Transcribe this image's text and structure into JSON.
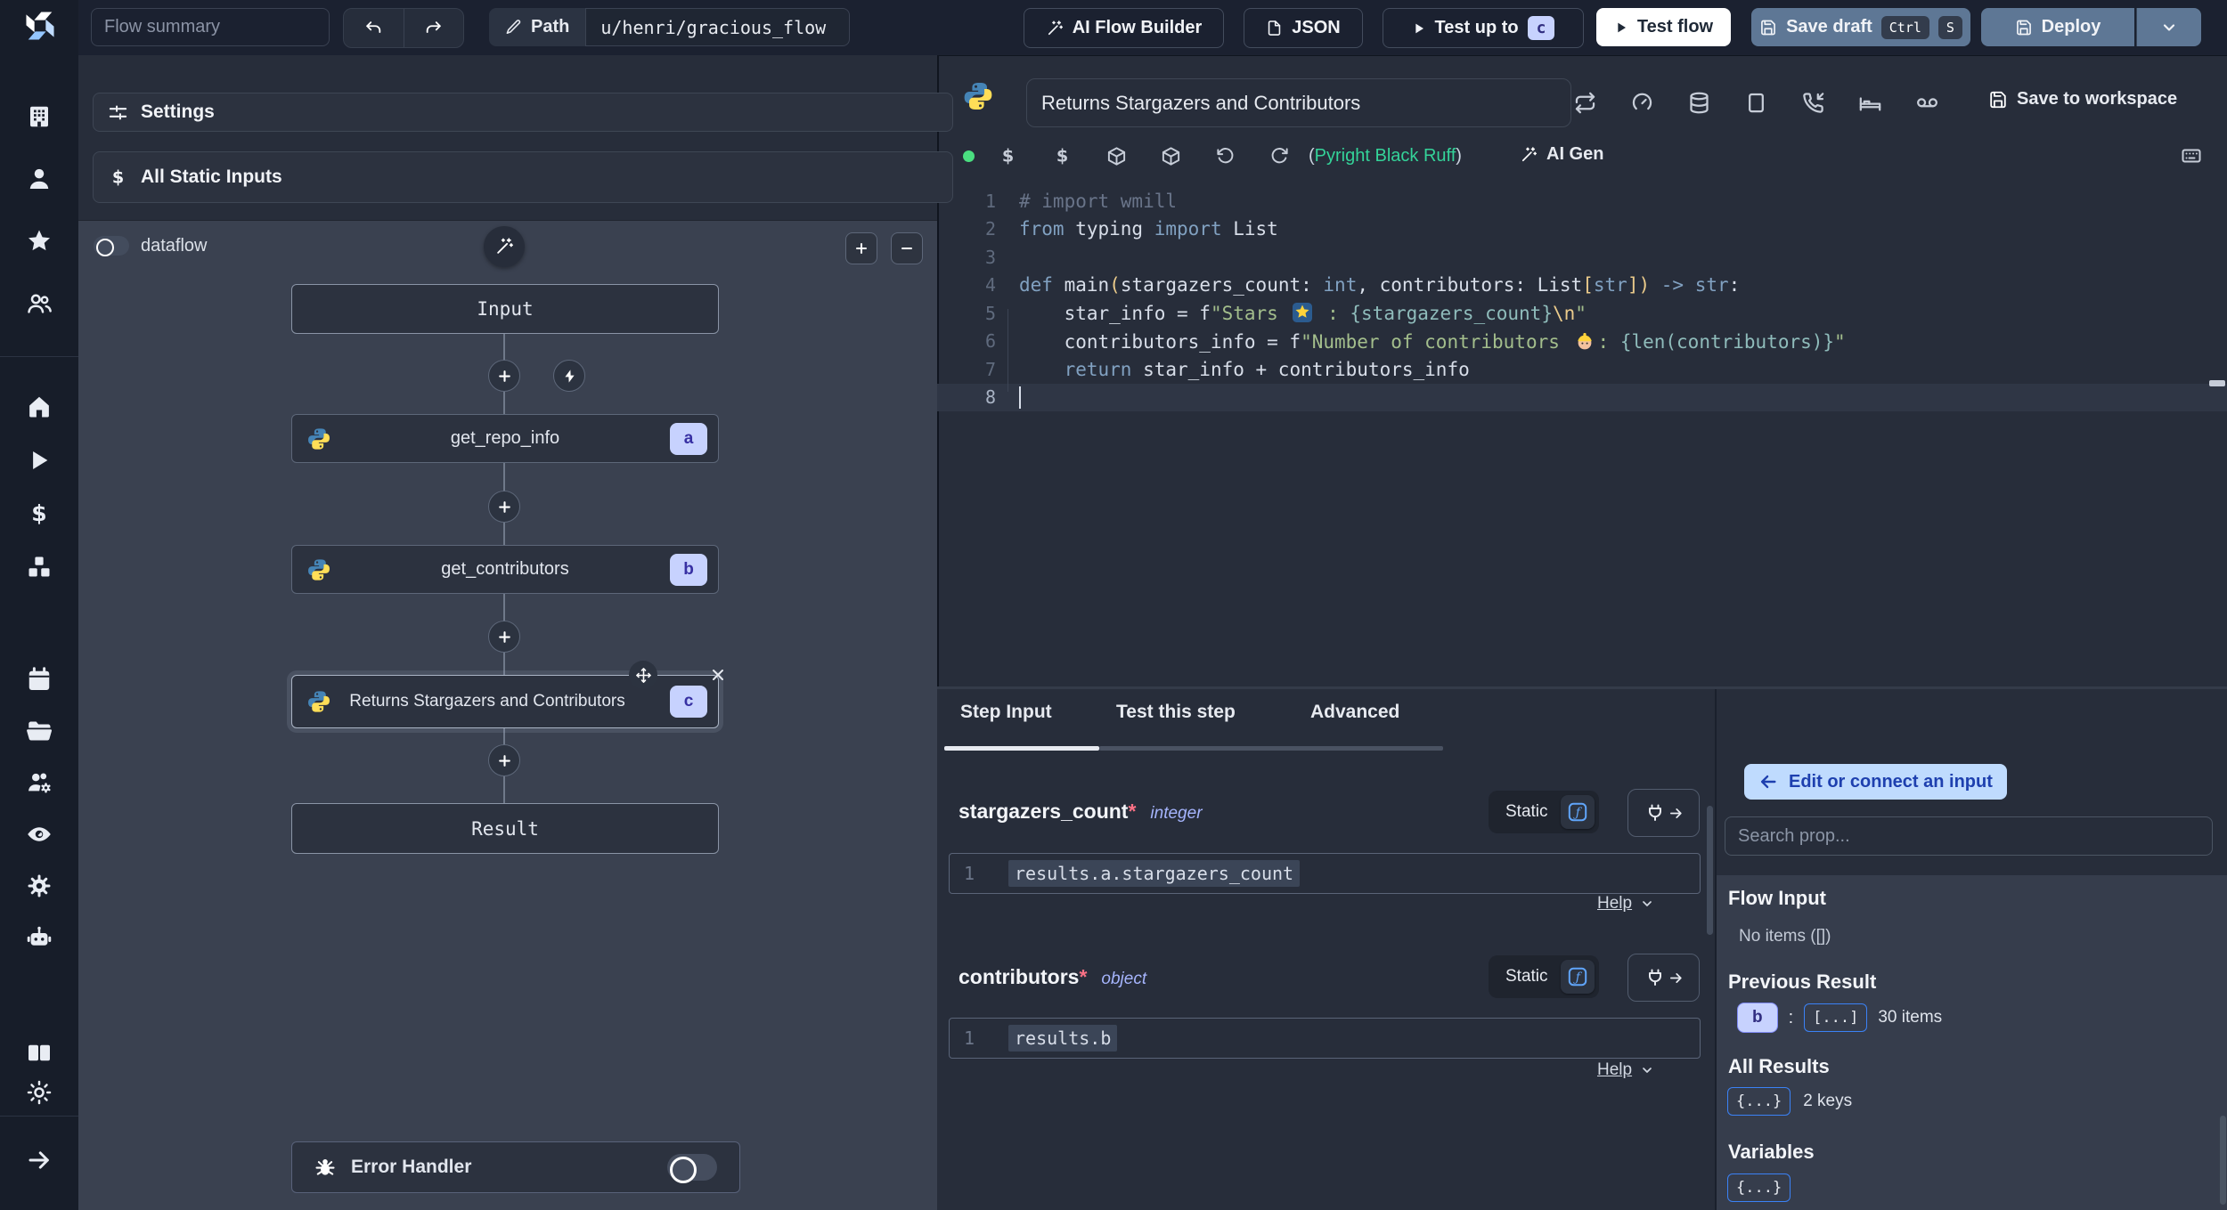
{
  "topbar": {
    "flow_summary": "Flow summary",
    "path_label": "Path",
    "path_value": "u/henri/gracious_flow",
    "ai_flow_builder": "AI Flow Builder",
    "json_button": "JSON",
    "test_up_to": "Test up to",
    "test_up_to_badge": "c",
    "test_flow": "Test flow",
    "save_draft": "Save draft",
    "kbd_ctrl": "Ctrl",
    "kbd_s": "S",
    "deploy": "Deploy"
  },
  "sidebar": {
    "groups": [
      [
        "building",
        "user",
        "star",
        "users"
      ],
      [
        "home",
        "play",
        "dollar",
        "boxes"
      ],
      [
        "calendar",
        "folder",
        "users-gear",
        "eye",
        "gear",
        "bot"
      ],
      [
        "book",
        "sun"
      ]
    ],
    "expand_icon": "arrow-right"
  },
  "flow_panel": {
    "settings": "Settings",
    "all_static_inputs": "All Static Inputs",
    "dataflow": "dataflow",
    "input_node": "Input",
    "steps": [
      {
        "id": "a",
        "label": "get_repo_info"
      },
      {
        "id": "b",
        "label": "get_contributors"
      },
      {
        "id": "c",
        "label": "Returns Stargazers and Contributors"
      }
    ],
    "result_node": "Result",
    "error_handler": "Error Handler"
  },
  "editor": {
    "title": "Returns Stargazers and Contributors",
    "header_icons": [
      "repeat",
      "gauge",
      "database",
      "square",
      "phone-incoming",
      "bed",
      "voicemail"
    ],
    "save_to_workspace": "Save to workspace",
    "toolbar_icons": [
      "dollar",
      "dollar",
      "package",
      "package",
      "rotate-ccw",
      "refresh"
    ],
    "lint_open": "(",
    "lint": "Pyright Black Ruff",
    "lint_close": ")",
    "ai_gen": "AI Gen",
    "code": {
      "lines": [
        {
          "tokens": [
            [
              "cm",
              "# import wmill"
            ]
          ]
        },
        {
          "tokens": [
            [
              "kw",
              "from"
            ],
            [
              "txt",
              " typing "
            ],
            [
              "kw",
              "import"
            ],
            [
              "txt",
              " List"
            ]
          ]
        },
        {
          "tokens": []
        },
        {
          "tokens": [
            [
              "kw",
              "def"
            ],
            [
              "txt",
              " "
            ],
            [
              "fn",
              "main"
            ],
            [
              "br",
              "("
            ],
            [
              "txt",
              "stargazers_count: "
            ],
            [
              "kw",
              "int"
            ],
            [
              "txt",
              ", contributors: List"
            ],
            [
              "br",
              "["
            ],
            [
              "kw",
              "str"
            ],
            [
              "br",
              "])"
            ],
            [
              "txt",
              " "
            ],
            [
              "kw",
              "->"
            ],
            [
              "txt",
              " "
            ],
            [
              "kw",
              "str"
            ],
            [
              "txt",
              ":"
            ]
          ]
        },
        {
          "tokens": [
            [
              "txt",
              "    star_info = f"
            ],
            [
              "str",
              "\"Stars "
            ],
            [
              "emoji",
              "star"
            ],
            [
              "str",
              " : "
            ],
            [
              "fstr",
              "{stargazers_count}"
            ],
            [
              "esc",
              "\\n"
            ],
            [
              "str",
              "\""
            ]
          ]
        },
        {
          "tokens": [
            [
              "txt",
              "    contributors_info = f"
            ],
            [
              "str",
              "\"Number of contributors "
            ],
            [
              "emoji",
              "worker"
            ],
            [
              "str",
              ": "
            ],
            [
              "fstr",
              "{len(contributors)}"
            ],
            [
              "str",
              "\""
            ]
          ]
        },
        {
          "tokens": [
            [
              "txt",
              "    "
            ],
            [
              "kw",
              "return"
            ],
            [
              "txt",
              " star_info + contributors_info"
            ]
          ]
        },
        {
          "tokens": [],
          "active": true
        }
      ]
    }
  },
  "step_panel": {
    "tabs": [
      "Step Input",
      "Test this step",
      "Advanced"
    ],
    "fields": [
      {
        "name": "stargazers_count",
        "required": "*",
        "type": "integer",
        "mode": "Static",
        "gutter": "1",
        "expr": "results.a.stargazers_count",
        "help": "Help"
      },
      {
        "name": "contributors",
        "required": "*",
        "type": "object",
        "mode": "Static",
        "gutter": "1",
        "expr": "results.b",
        "help": "Help"
      }
    ]
  },
  "connect_panel": {
    "back_button": "Edit or connect an input",
    "search_placeholder": "Search prop...",
    "flow_input_title": "Flow Input",
    "flow_input_empty": "No items ([])",
    "previous_result_title": "Previous Result",
    "previous_result_key": "b",
    "previous_result_sep": ":",
    "previous_result_value": "[...]",
    "previous_result_count": "30 items",
    "all_results_title": "All Results",
    "all_results_badge": "{...}",
    "all_results_count": "2 keys",
    "variables_title": "Variables",
    "variables_badge": "{...}"
  },
  "colors": {
    "accent_blue": "#3b82f6",
    "badge_lavender": "#c7d2fe",
    "button_slate": "#5e7795",
    "success_green": "#34d399",
    "editor_string": "#a3be8c",
    "editor_keyword": "#81a1c1",
    "graph_bg": "#3a4150",
    "panel_bg": "#272d3a"
  }
}
